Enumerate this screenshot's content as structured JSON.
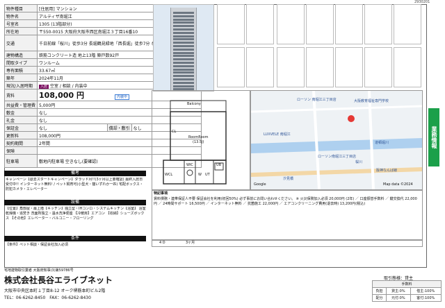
{
  "corner_code": "2930201",
  "spec": {
    "rows": [
      {
        "k": "物件種目",
        "v": "[住居用] マンション"
      },
      {
        "k": "物件名",
        "v": "アルティザ南堀江"
      },
      {
        "k": "号室名",
        "v": "1305 (13階部分)"
      },
      {
        "k": "所在地",
        "v": "〒550-0015 大阪府大阪市西区南堀江３丁目16番10"
      },
      {
        "k": "交通",
        "v": "千日前線「桜川」徒歩3分 長堀鶴見緑地「西長堀」徒歩7分 なんば線「桜川」徒歩4分"
      },
      {
        "k": "建物構造",
        "v": "鉄筋コンクリート造 地上13階 築戸数92戸"
      },
      {
        "k": "間取タイプ",
        "v": "ワンルーム"
      },
      {
        "k": "専有面積",
        "v": "33.67㎡"
      },
      {
        "k": "築年",
        "v": "2024年11月"
      }
    ],
    "status_label": "現況/入居時期",
    "status_tag": "入居",
    "status_text": "空室 / 相談 / 内装中",
    "rent_label": "賃料",
    "rent_value": "108,000 円",
    "rent_pill": "内装中",
    "rows2": [
      {
        "k": "共益費・管理費",
        "v": "5,000円"
      },
      {
        "k": "敷金",
        "v": "なし"
      },
      {
        "k": "礼金",
        "v": "なし"
      },
      {
        "k": "保証金",
        "v": "なし",
        "k2": "償却・敷引",
        "v2": "なし"
      },
      {
        "k": "更新料",
        "v": "108,000円"
      },
      {
        "k": "契約期間",
        "v": "2年間"
      },
      {
        "k": "保険",
        "v": ""
      },
      {
        "k": "駐車場",
        "v": "敷地内駐車場 空きなし(要確認)"
      }
    ],
    "bikou_header": "備考",
    "bikou_text": "キャンペーン【退去スタートキャンペーン】ダラッド月!!(3ヶ月以上要確認) 最終入居日受付中!! インターネット無料! / ペット飼育可(小型犬・猫いずれか一匹) 宅配ボックス・防犯カメラ・エレベーター",
    "setsubi_header": "設備",
    "setsubi_text": "【位置】角部屋・最上階【キッチン】独立型・IHコンロ・システムキッチン【浴室】 浴室乾燥機・追焚き 洗面所独立・温水洗浄便座 【冷暖房】エアコン 【収納】シューズボックス 【その他】エレベーター・バルコニー・フローリング",
    "jouken_header": "条件",
    "jouken_text": "【条件】ペット相談・保証会社加入必須"
  },
  "notes": {
    "header": "特記事項",
    "text": "賃料債務・連帯保証人不要 保証会社を利用(初回50%) 必ず事前にお問い合わせください。 ※ 火災保険加入必須 20,000円 (2年) ／ 口座振替手数料 ／ 鍵交換代 22,000円 ／ 24時間サポート 16,500円 ／ インターネット無料 ／ 抗菌施工 22,000円 ／ エアコンクリーニング費用(退去時) 13,200円(税込)",
    "tabs": [
      "4 D",
      "3ヶ月"
    ]
  },
  "plan": {
    "balcony": "Balcony",
    "room_label": "RoomRoom",
    "room_sub": "(13.5J)",
    "labels": [
      "CL",
      "WCL",
      "WIC",
      "UB",
      "W",
      "UT"
    ]
  },
  "map": {
    "labels": [
      {
        "t": "ローソン 南堀江三丁目店"
      },
      {
        "t": "大阪教育福祉専門学校"
      },
      {
        "t": "LUXVELE 南堀江"
      },
      {
        "t": "ローソン南堀江三丁目店"
      },
      {
        "t": "道頓堀川"
      },
      {
        "t": "桜川"
      },
      {
        "t": "阪神なんば線"
      },
      {
        "t": "汐見橋"
      },
      {
        "t": "Google"
      },
      {
        "t": "Map data ©2024"
      }
    ]
  },
  "right_tab": "業務情報",
  "footer": {
    "license": "宅地建物取引業者 大阪府知事(3)第59786号",
    "company": "株式会社長谷エライブネット",
    "address": "大阪市中央区本町１丁目8-12 オーク堺筋本町ビル2階",
    "tel": "TEL：06-6262-8450　FAX：06-6262-8430",
    "torihiki_label": "取引態様：貸主",
    "fee_header": "手数料",
    "fee_rows": [
      [
        "負担",
        "貸主:0%",
        "借主:100%"
      ],
      [
        "配分",
        "元付:0%",
        "客付:100%"
      ]
    ]
  }
}
